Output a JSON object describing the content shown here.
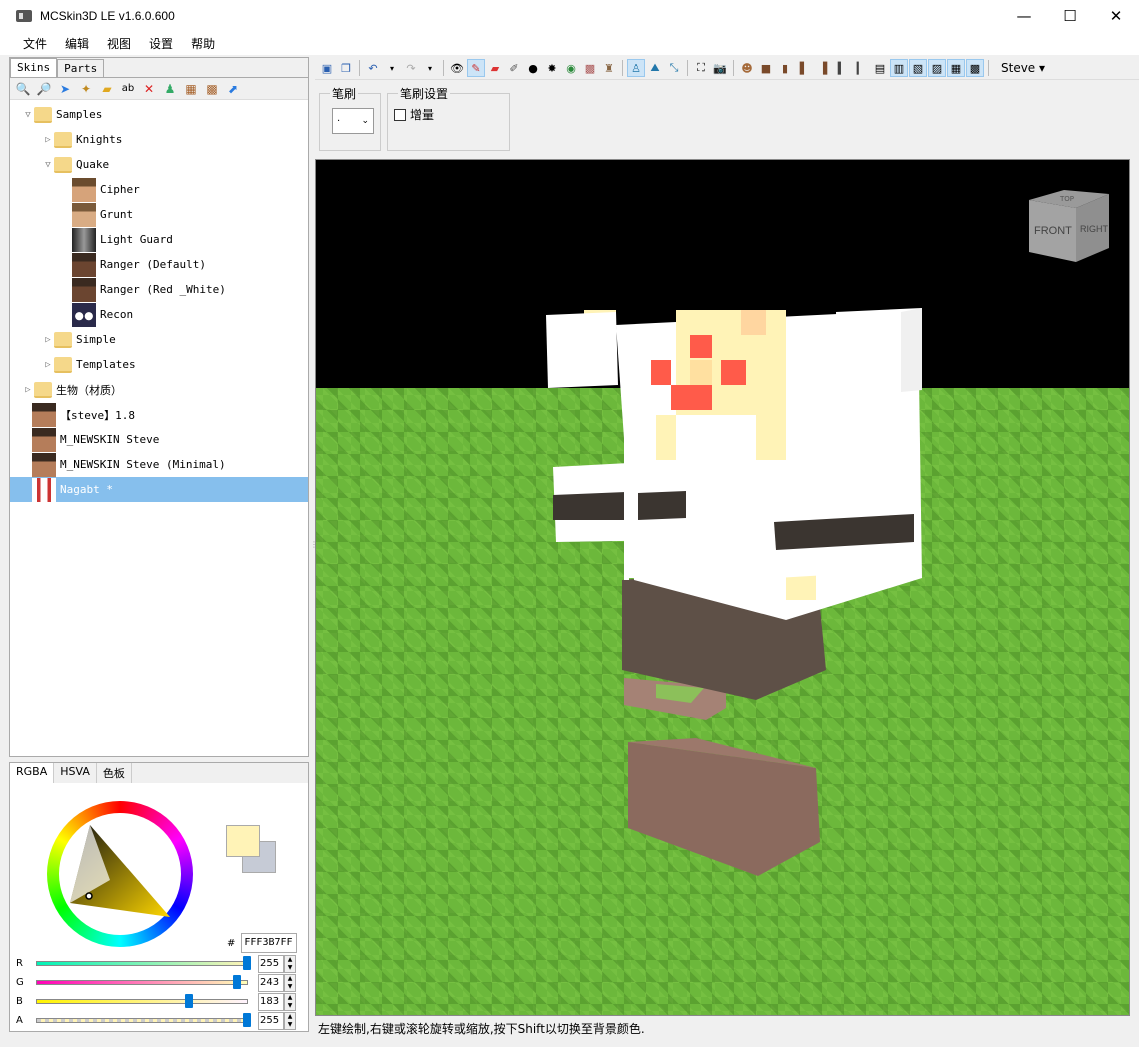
{
  "window": {
    "title": "MCSkin3D LE v1.6.0.600",
    "minimize": "—",
    "maximize": "☐",
    "close": "✕"
  },
  "menu": [
    "文件",
    "编辑",
    "视图",
    "设置",
    "帮助"
  ],
  "left_tabs": [
    "Skins",
    "Parts"
  ],
  "tree": [
    {
      "label": "Samples",
      "type": "folder",
      "level": 0,
      "expanded": true
    },
    {
      "label": "Knights",
      "type": "folder",
      "level": 1,
      "expanded": false
    },
    {
      "label": "Quake",
      "type": "folder",
      "level": 1,
      "expanded": true
    },
    {
      "label": "Cipher",
      "type": "skin",
      "level": 2
    },
    {
      "label": "Grunt",
      "type": "skin",
      "level": 2
    },
    {
      "label": "Light Guard",
      "type": "skin",
      "level": 2
    },
    {
      "label": "Ranger (Default)",
      "type": "skin",
      "level": 2
    },
    {
      "label": "Ranger (Red _White)",
      "type": "skin",
      "level": 2
    },
    {
      "label": "Recon",
      "type": "skin",
      "level": 2
    },
    {
      "label": "Simple",
      "type": "folder",
      "level": 1,
      "expanded": false
    },
    {
      "label": "Templates",
      "type": "folder",
      "level": 1,
      "expanded": false
    },
    {
      "label": "生物（材质）",
      "type": "folder",
      "level": 0,
      "expanded": false
    },
    {
      "label": "【steve】1.8",
      "type": "skin",
      "level": 0
    },
    {
      "label": "M_NEWSKIN Steve",
      "type": "skin",
      "level": 0
    },
    {
      "label": "M_NEWSKIN Steve (Minimal)",
      "type": "skin",
      "level": 0
    },
    {
      "label": "Nagabt *",
      "type": "skin",
      "level": 0,
      "selected": true
    }
  ],
  "color_tabs": [
    "RGBA",
    "HSVA",
    "色板"
  ],
  "color": {
    "hex_prefix": "#",
    "hex": "FFF3B7FF",
    "foreground": "#fff3b7",
    "background": "#c6cbd6",
    "channels": [
      {
        "label": "R",
        "value": 255
      },
      {
        "label": "G",
        "value": 243
      },
      {
        "label": "B",
        "value": 183
      },
      {
        "label": "A",
        "value": 255
      }
    ]
  },
  "toolbar": {
    "model_select": "Steve ▾"
  },
  "brush": {
    "group_label": "笔刷",
    "select_value": "·",
    "settings_label": "笔刷设置",
    "increment_label": "增量"
  },
  "viewcube": {
    "front": "FRONT",
    "right": "RIGHT",
    "top": "TOP"
  },
  "status": "左键绘制,右键或滚轮旋转或缩放,按下Shift以切换至背景颜色."
}
